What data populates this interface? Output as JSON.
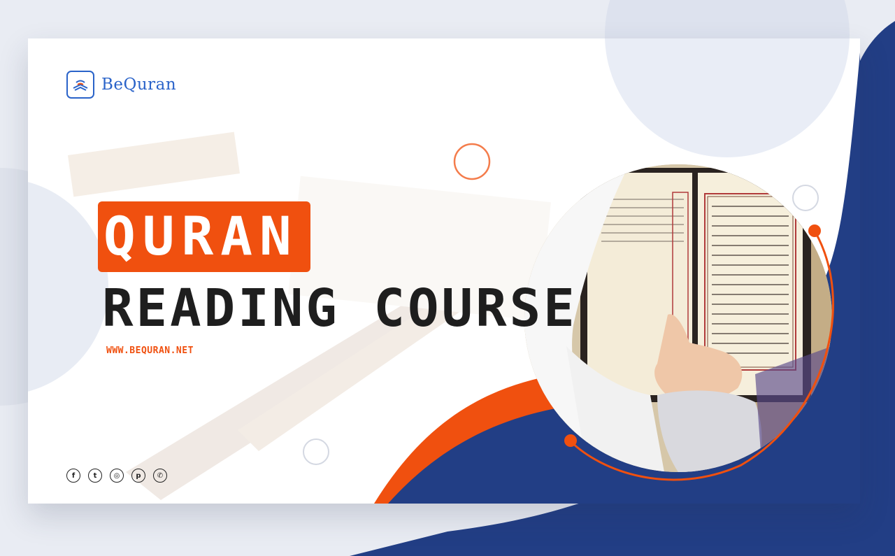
{
  "brand": {
    "name": "BeQuran"
  },
  "headline": {
    "line1": "QURAN",
    "line2": "READING COURSE"
  },
  "website": "WWW.BEQURAN.NET",
  "socials": [
    {
      "icon": "facebook-icon",
      "glyph": "f"
    },
    {
      "icon": "twitter-icon",
      "glyph": "t"
    },
    {
      "icon": "instagram-icon",
      "glyph": "◎"
    },
    {
      "icon": "pinterest-icon",
      "glyph": "p"
    },
    {
      "icon": "whatsapp-icon",
      "glyph": "✆"
    }
  ],
  "colors": {
    "accent": "#f0500f",
    "navy": "#223e85",
    "brand_blue": "#2a63c9",
    "text_dark": "#1e1e1e"
  }
}
